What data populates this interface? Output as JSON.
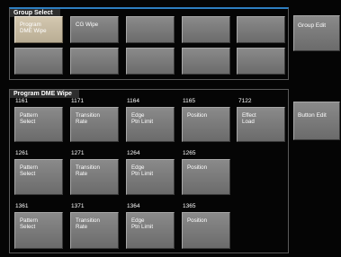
{
  "group_select": {
    "title": "Group Select",
    "buttons": [
      {
        "label": "Program\nDME Wipe",
        "active": true
      },
      {
        "label": "CG Wipe",
        "active": false
      },
      {
        "label": "",
        "active": false
      },
      {
        "label": "",
        "active": false
      },
      {
        "label": "",
        "active": false
      },
      {
        "label": "",
        "active": false
      },
      {
        "label": "",
        "active": false
      },
      {
        "label": "",
        "active": false
      },
      {
        "label": "",
        "active": false
      },
      {
        "label": "",
        "active": false
      }
    ]
  },
  "program_dme_wipe": {
    "title": "Program DME Wipe",
    "rows": [
      {
        "numbers": [
          "1161",
          "1171",
          "1164",
          "1165",
          "7122"
        ],
        "labels": [
          "Pattern\nSelect",
          "Transition\nRate",
          "Edge\nPtn Limit",
          "Position",
          "Effect\nLoad"
        ]
      },
      {
        "numbers": [
          "1261",
          "1271",
          "1264",
          "1265"
        ],
        "labels": [
          "Pattern\nSelect",
          "Transition\nRate",
          "Edge\nPtn Limit",
          "Position"
        ]
      },
      {
        "numbers": [
          "1361",
          "1371",
          "1364",
          "1365"
        ],
        "labels": [
          "Pattern\nSelect",
          "Transition\nRate",
          "Edge\nPtn Limit",
          "Position"
        ]
      }
    ]
  },
  "side": {
    "group_edit": "Group Edit",
    "button_edit": "Button Edit"
  },
  "colors": {
    "background": "#050505",
    "button": "#7a7a7a",
    "active_button": "#c8bca4",
    "accent_line": "#2d7fc1"
  }
}
